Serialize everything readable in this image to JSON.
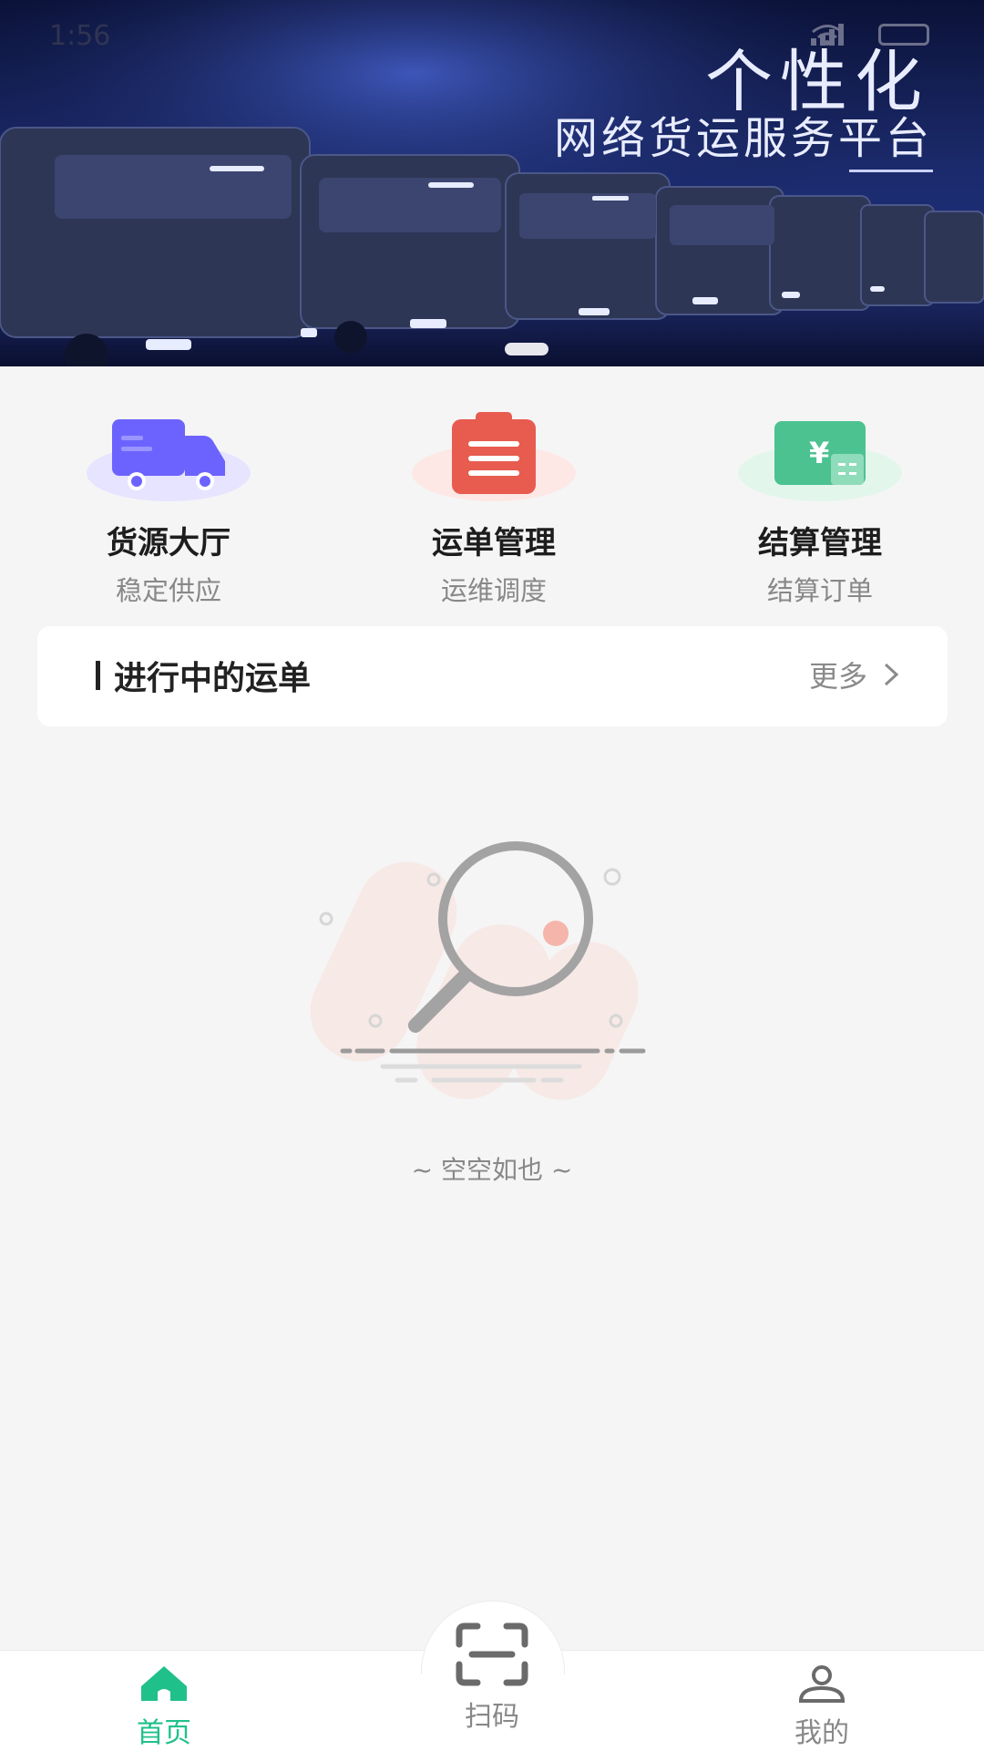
{
  "status_bar": {
    "time": "1:56"
  },
  "banner": {
    "title": "个性化",
    "subtitle": "网络货运服务平台"
  },
  "quick_nav": [
    {
      "label": "货源大厅",
      "sub": "稳定供应",
      "icon": "truck-icon",
      "color": "#6c63ff"
    },
    {
      "label": "运单管理",
      "sub": "运维调度",
      "icon": "clipboard-icon",
      "color": "#e85b4f"
    },
    {
      "label": "结算管理",
      "sub": "结算订单",
      "icon": "ticket-icon",
      "color": "#4cc290"
    }
  ],
  "ongoing": {
    "title": "进行中的运单",
    "more": "更多"
  },
  "empty": {
    "text": "~ 空空如也 ~"
  },
  "tabbar": {
    "home": "首页",
    "scan": "扫码",
    "mine": "我的",
    "active_color": "#20c08a"
  }
}
